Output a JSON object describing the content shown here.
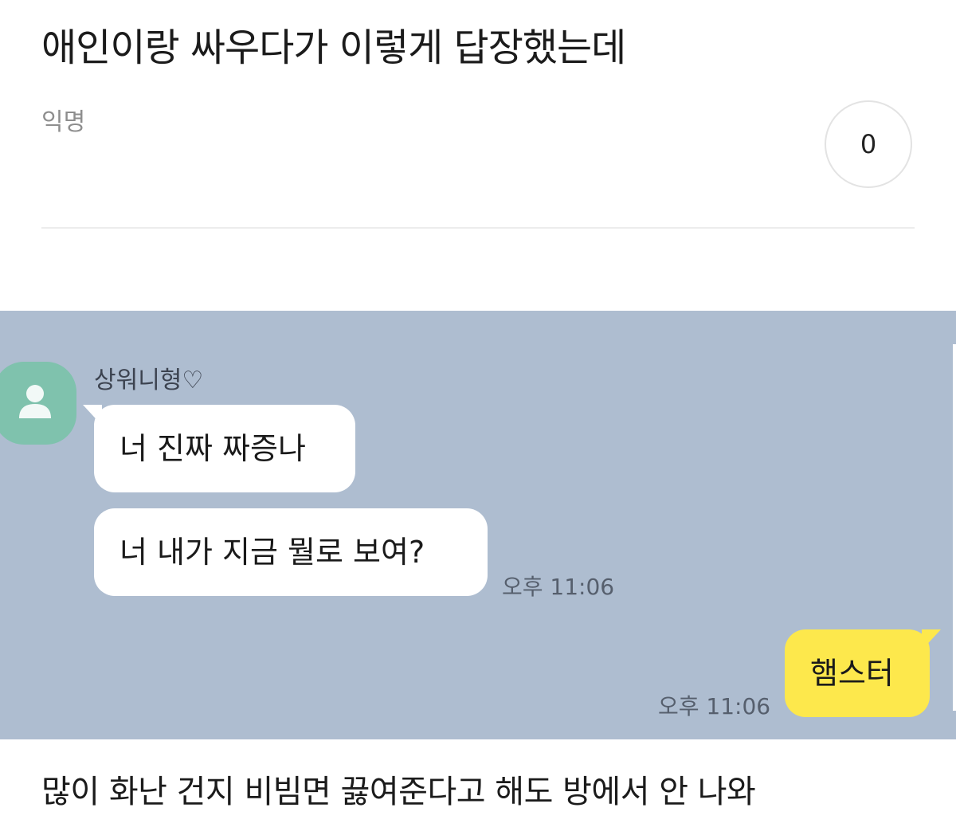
{
  "post": {
    "title": "애인이랑 싸우다가 이렇게 답장했는데",
    "author": "익명",
    "comment_count": "0",
    "caption": "많이 화난 건지 비빔면 끓여준다고 해도 방에서 안 나와"
  },
  "chat": {
    "background_color": "#aebdd0",
    "sender": {
      "name": "상워니형♡",
      "avatar_icon": "person-icon"
    },
    "messages": [
      {
        "direction": "incoming",
        "text": "너 진짜 짜증나"
      },
      {
        "direction": "incoming",
        "text": "너 내가 지금 뭘로 보여?",
        "time": "오후 11:06"
      },
      {
        "direction": "outgoing",
        "text": "햄스터",
        "time": "오후 11:06"
      }
    ]
  }
}
